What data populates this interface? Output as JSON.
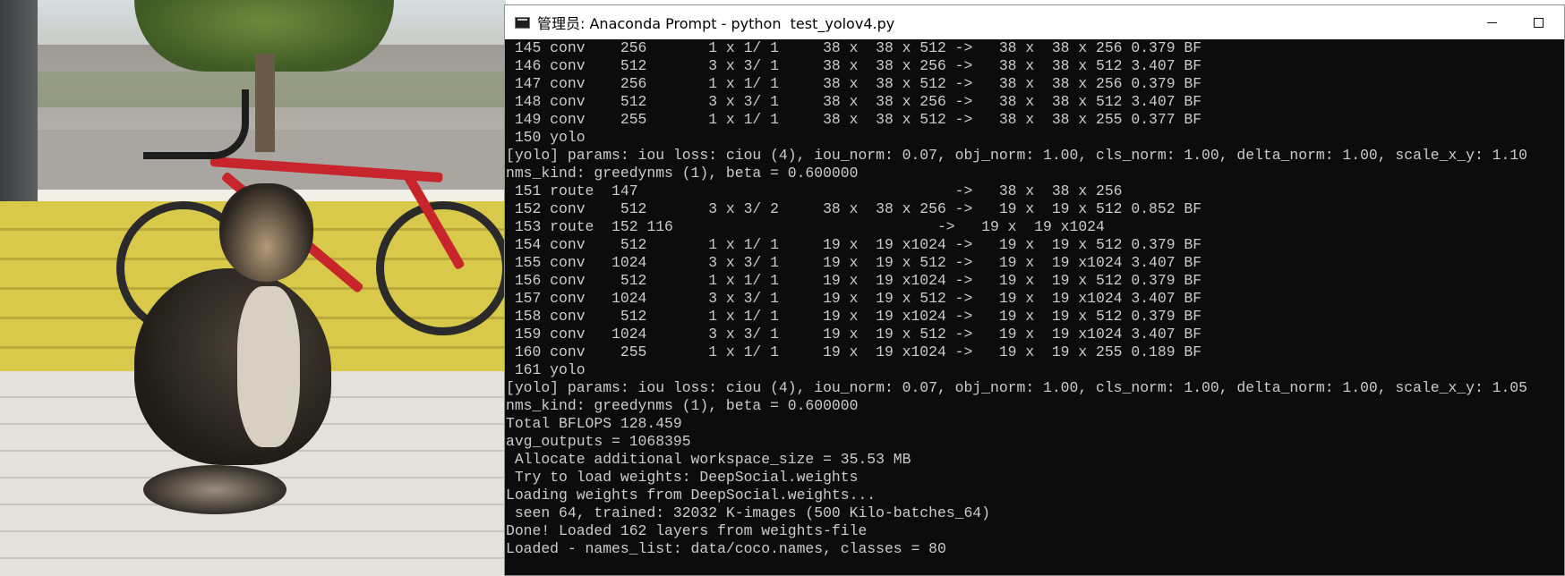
{
  "window": {
    "title": "管理员: Anaconda Prompt - python  test_yolov4.py",
    "icon": "console-icon"
  },
  "controls": {
    "minimize_icon": "minimize-icon",
    "maximize_icon": "maximize-icon"
  },
  "console": {
    "lines": [
      " 145 conv    256       1 x 1/ 1     38 x  38 x 512 ->   38 x  38 x 256 0.379 BF",
      " 146 conv    512       3 x 3/ 1     38 x  38 x 256 ->   38 x  38 x 512 3.407 BF",
      " 147 conv    256       1 x 1/ 1     38 x  38 x 512 ->   38 x  38 x 256 0.379 BF",
      " 148 conv    512       3 x 3/ 1     38 x  38 x 256 ->   38 x  38 x 512 3.407 BF",
      " 149 conv    255       1 x 1/ 1     38 x  38 x 512 ->   38 x  38 x 255 0.377 BF",
      " 150 yolo",
      "[yolo] params: iou loss: ciou (4), iou_norm: 0.07, obj_norm: 1.00, cls_norm: 1.00, delta_norm: 1.00, scale_x_y: 1.10",
      "nms_kind: greedynms (1), beta = 0.600000",
      " 151 route  147                                    ->   38 x  38 x 256",
      " 152 conv    512       3 x 3/ 2     38 x  38 x 256 ->   19 x  19 x 512 0.852 BF",
      " 153 route  152 116                              ->   19 x  19 x1024",
      " 154 conv    512       1 x 1/ 1     19 x  19 x1024 ->   19 x  19 x 512 0.379 BF",
      " 155 conv   1024       3 x 3/ 1     19 x  19 x 512 ->   19 x  19 x1024 3.407 BF",
      " 156 conv    512       1 x 1/ 1     19 x  19 x1024 ->   19 x  19 x 512 0.379 BF",
      " 157 conv   1024       3 x 3/ 1     19 x  19 x 512 ->   19 x  19 x1024 3.407 BF",
      " 158 conv    512       1 x 1/ 1     19 x  19 x1024 ->   19 x  19 x 512 0.379 BF",
      " 159 conv   1024       3 x 3/ 1     19 x  19 x 512 ->   19 x  19 x1024 3.407 BF",
      " 160 conv    255       1 x 1/ 1     19 x  19 x1024 ->   19 x  19 x 255 0.189 BF",
      " 161 yolo",
      "[yolo] params: iou loss: ciou (4), iou_norm: 0.07, obj_norm: 1.00, cls_norm: 1.00, delta_norm: 1.00, scale_x_y: 1.05",
      "nms_kind: greedynms (1), beta = 0.600000",
      "Total BFLOPS 128.459",
      "avg_outputs = 1068395",
      " Allocate additional workspace_size = 35.53 MB",
      " Try to load weights: DeepSocial.weights",
      "Loading weights from DeepSocial.weights...",
      " seen 64, trained: 32032 K-images (500 Kilo-batches_64)",
      "Done! Loaded 162 layers from weights-file",
      "Loaded - names_list: data/coco.names, classes = 80"
    ]
  },
  "colors": {
    "console_bg": "#0c0c0c",
    "console_text": "#cccccc",
    "titlebar_bg": "#ffffff"
  }
}
